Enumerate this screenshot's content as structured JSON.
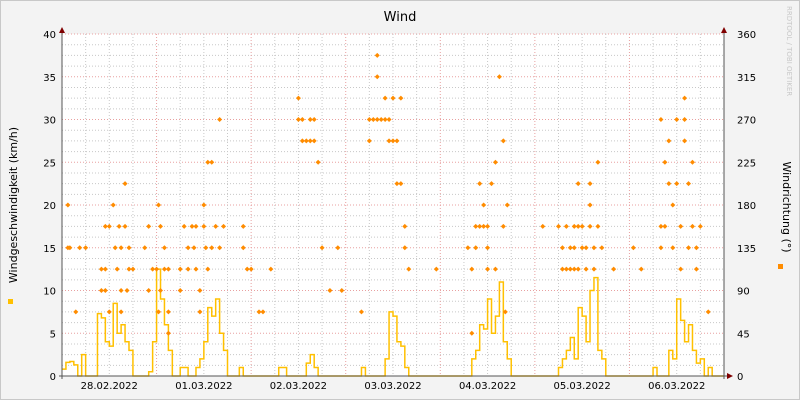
{
  "chart_data": {
    "type": "line",
    "title": "Wind",
    "ylabel": "Windgeschwindigkeit (km/h)",
    "ylabel_right": "Windrichtung (°)",
    "watermark": "RRDTOOL / TOBI OETIKER",
    "ylim": [
      0,
      40
    ],
    "ylim_right": [
      0,
      360
    ],
    "yticks": [
      "0",
      "5",
      "10",
      "15",
      "20",
      "25",
      "30",
      "35",
      "40"
    ],
    "yticks_right": [
      "0",
      "45",
      "90",
      "135",
      "180",
      "225",
      "270",
      "315",
      "360"
    ],
    "x_unit": "hours since 28.02.2022 00:00",
    "xlim": [
      0,
      168
    ],
    "xtick_labels": [
      "28.02.2022",
      "01.03.2022",
      "02.03.2022",
      "03.03.2022",
      "04.03.2022",
      "05.03.2022",
      "06.03.2022"
    ],
    "grid": true,
    "colors": {
      "speed": "#ffc000",
      "direction": "#ff8c00",
      "major_grid": "#e8a0a0",
      "minor_grid": "#c8c8c8",
      "arrow": "#800000"
    },
    "series": [
      {
        "name": "Windgeschwindigkeit",
        "axis": "left",
        "style": "step",
        "values": [
          0.8,
          1.6,
          1.7,
          1.3,
          0,
          2.5,
          0,
          0,
          0,
          7.3,
          6.8,
          4,
          3.5,
          8.5,
          5,
          6,
          4,
          3,
          0,
          0,
          0,
          0,
          0.5,
          4,
          12.5,
          9,
          6,
          3,
          0,
          0,
          1,
          1,
          0,
          0,
          1,
          2,
          4,
          8,
          7,
          9,
          5,
          3,
          0,
          0,
          0,
          1,
          0,
          0,
          0,
          0,
          0,
          0,
          0,
          0,
          0,
          1,
          1,
          0,
          0,
          0,
          0,
          0,
          1.5,
          2.5,
          1,
          0,
          0,
          0,
          0,
          0,
          0,
          0,
          0,
          0,
          0,
          0,
          1,
          0,
          0,
          0,
          0,
          0,
          2,
          7.5,
          7,
          4,
          3.5,
          1,
          0,
          0,
          0,
          0,
          0,
          0,
          0,
          0,
          0,
          0,
          0,
          0,
          0,
          0,
          0,
          0,
          2,
          3,
          6,
          5.5,
          9,
          5,
          7,
          11,
          4,
          2,
          0,
          0,
          0,
          0,
          0,
          0,
          0,
          0,
          0,
          0,
          0,
          0,
          1,
          2,
          3,
          4.5,
          2,
          8,
          7,
          4,
          10,
          11.5,
          3,
          2,
          0,
          0,
          0,
          0,
          0,
          0,
          0,
          0,
          0,
          0,
          0,
          0,
          1,
          0,
          0,
          0,
          3,
          2,
          9,
          6.5,
          4,
          6,
          3,
          1.5,
          2,
          0,
          1,
          0,
          0,
          0
        ]
      },
      {
        "name": "Windrichtung",
        "axis": "right",
        "style": "points",
        "points": [
          [
            1.5,
            180
          ],
          [
            1.5,
            135
          ],
          [
            2,
            135
          ],
          [
            4.5,
            135
          ],
          [
            6,
            135
          ],
          [
            3.5,
            67.5
          ],
          [
            10,
            112.5
          ],
          [
            11,
            112.5
          ],
          [
            10,
            90
          ],
          [
            11,
            90
          ],
          [
            11,
            157.5
          ],
          [
            12,
            157.5
          ],
          [
            12,
            67.5
          ],
          [
            13,
            180
          ],
          [
            13.5,
            135
          ],
          [
            14,
            112.5
          ],
          [
            14.5,
            157.5
          ],
          [
            15,
            135
          ],
          [
            15,
            90
          ],
          [
            15,
            67.5
          ],
          [
            16,
            202.5
          ],
          [
            16,
            157.5
          ],
          [
            17,
            112.5
          ],
          [
            16.5,
            90
          ],
          [
            17,
            135
          ],
          [
            18,
            112.5
          ],
          [
            21,
            135
          ],
          [
            22,
            157.5
          ],
          [
            22,
            90
          ],
          [
            23,
            112.5
          ],
          [
            24,
            112.5
          ],
          [
            24.5,
            180
          ],
          [
            24.5,
            67.5
          ],
          [
            25,
            157.5
          ],
          [
            25,
            90
          ],
          [
            26,
            112.5
          ],
          [
            26,
            135
          ],
          [
            27,
            112.5
          ],
          [
            27,
            67.5
          ],
          [
            27,
            45
          ],
          [
            30,
            112.5
          ],
          [
            30,
            90
          ],
          [
            31,
            157.5
          ],
          [
            32,
            135
          ],
          [
            32,
            112.5
          ],
          [
            33,
            157.5
          ],
          [
            33.5,
            135
          ],
          [
            34,
            112.5
          ],
          [
            34,
            157.5
          ],
          [
            35,
            90
          ],
          [
            35,
            67.5
          ],
          [
            36,
            180
          ],
          [
            36,
            157.5
          ],
          [
            36.5,
            135
          ],
          [
            37,
            112.5
          ],
          [
            37,
            225
          ],
          [
            38,
            225
          ],
          [
            38,
            135
          ],
          [
            39,
            157.5
          ],
          [
            40,
            270
          ],
          [
            40,
            135
          ],
          [
            41,
            157.5
          ],
          [
            46,
            157.5
          ],
          [
            46,
            135
          ],
          [
            47,
            112.5
          ],
          [
            48,
            112.5
          ],
          [
            50,
            67.5
          ],
          [
            51,
            67.5
          ],
          [
            53,
            112.5
          ],
          [
            60,
            292.5
          ],
          [
            60,
            270
          ],
          [
            61,
            247.5
          ],
          [
            61,
            270
          ],
          [
            62,
            247.5
          ],
          [
            63,
            247.5
          ],
          [
            63,
            270
          ],
          [
            64,
            247.5
          ],
          [
            64,
            270
          ],
          [
            65,
            225
          ],
          [
            66,
            135
          ],
          [
            68,
            90
          ],
          [
            70,
            135
          ],
          [
            71,
            90
          ],
          [
            76,
            67.5
          ],
          [
            78,
            247.5
          ],
          [
            78,
            270
          ],
          [
            79,
            270
          ],
          [
            80,
            270
          ],
          [
            80,
            337.5
          ],
          [
            80,
            315
          ],
          [
            81,
            270
          ],
          [
            82,
            270
          ],
          [
            82,
            292.5
          ],
          [
            83,
            247.5
          ],
          [
            83,
            270
          ],
          [
            84,
            247.5
          ],
          [
            84,
            292.5
          ],
          [
            85,
            247.5
          ],
          [
            85,
            202.5
          ],
          [
            86,
            292.5
          ],
          [
            86,
            202.5
          ],
          [
            87,
            157.5
          ],
          [
            87,
            135
          ],
          [
            88,
            112.5
          ],
          [
            95,
            112.5
          ],
          [
            103,
            135
          ],
          [
            104,
            45
          ],
          [
            104,
            112.5
          ],
          [
            105,
            157.5
          ],
          [
            105,
            135
          ],
          [
            106,
            157.5
          ],
          [
            106,
            202.5
          ],
          [
            107,
            157.5
          ],
          [
            107,
            180
          ],
          [
            108,
            112.5
          ],
          [
            108,
            135
          ],
          [
            108,
            157.5
          ],
          [
            109,
            202.5
          ],
          [
            110,
            112.5
          ],
          [
            110,
            225
          ],
          [
            111,
            315
          ],
          [
            112,
            157.5
          ],
          [
            112,
            247.5
          ],
          [
            113,
            180
          ],
          [
            112.5,
            67.5
          ],
          [
            122,
            157.5
          ],
          [
            126,
            157.5
          ],
          [
            127,
            112.5
          ],
          [
            127,
            135
          ],
          [
            128,
            157.5
          ],
          [
            128,
            112.5
          ],
          [
            129,
            112.5
          ],
          [
            129,
            135
          ],
          [
            130,
            157.5
          ],
          [
            130,
            112.5
          ],
          [
            130,
            135
          ],
          [
            131,
            157.5
          ],
          [
            131,
            112.5
          ],
          [
            131,
            202.5
          ],
          [
            132,
            135
          ],
          [
            132,
            157.5
          ],
          [
            133,
            112.5
          ],
          [
            133,
            135
          ],
          [
            134,
            157.5
          ],
          [
            134,
            180
          ],
          [
            134,
            202.5
          ],
          [
            135,
            112.5
          ],
          [
            135,
            135
          ],
          [
            136,
            157.5
          ],
          [
            136,
            225
          ],
          [
            137,
            135
          ],
          [
            140,
            112.5
          ],
          [
            145,
            135
          ],
          [
            147,
            112.5
          ],
          [
            152,
            157.5
          ],
          [
            152,
            135
          ],
          [
            152,
            270
          ],
          [
            153,
            157.5
          ],
          [
            153,
            225
          ],
          [
            154,
            202.5
          ],
          [
            154,
            247.5
          ],
          [
            155,
            135
          ],
          [
            155,
            180
          ],
          [
            156,
            270
          ],
          [
            156,
            202.5
          ],
          [
            157,
            112.5
          ],
          [
            157,
            157.5
          ],
          [
            158,
            247.5
          ],
          [
            158,
            292.5
          ],
          [
            158,
            270
          ],
          [
            159,
            135
          ],
          [
            159,
            202.5
          ],
          [
            160,
            157.5
          ],
          [
            160,
            225
          ],
          [
            161,
            112.5
          ],
          [
            161,
            135
          ],
          [
            162,
            157.5
          ],
          [
            164,
            67.5
          ]
        ]
      }
    ]
  }
}
